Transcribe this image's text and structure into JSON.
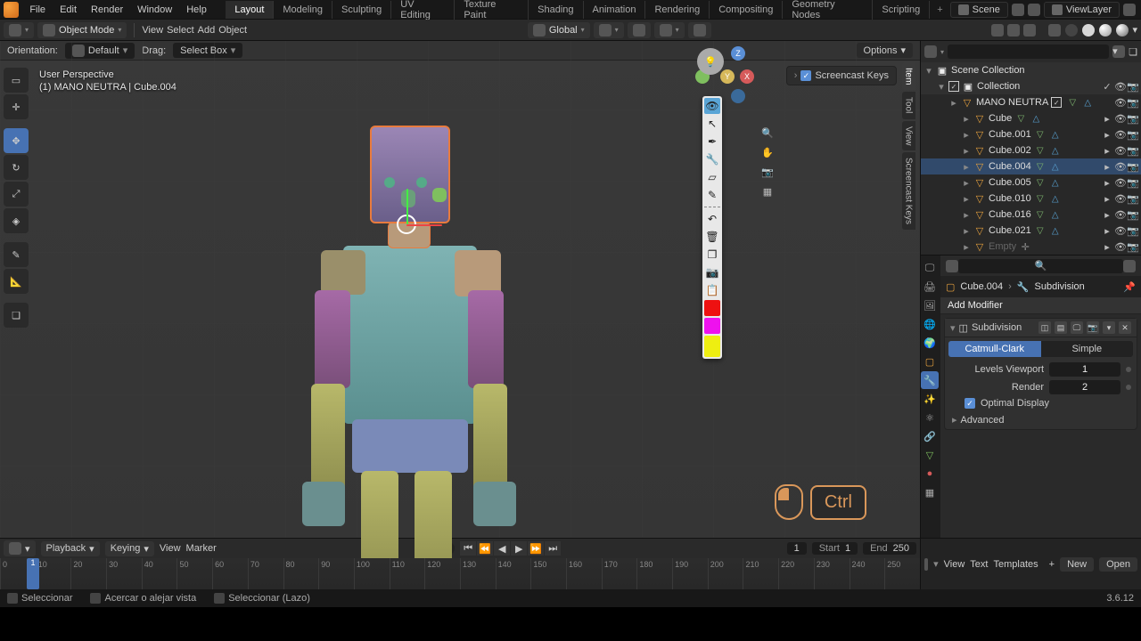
{
  "topbar": {
    "menus": [
      "File",
      "Edit",
      "Render",
      "Window",
      "Help"
    ],
    "workspaces": [
      "Layout",
      "Modeling",
      "Sculpting",
      "UV Editing",
      "Texture Paint",
      "Shading",
      "Animation",
      "Rendering",
      "Compositing",
      "Geometry Nodes",
      "Scripting"
    ],
    "active_workspace": 0,
    "scene_label": "Scene",
    "viewlayer_label": "ViewLayer"
  },
  "secondary": {
    "mode": "Object Mode",
    "menus": [
      "View",
      "Select",
      "Add",
      "Object"
    ],
    "orientation_label": "Global",
    "options_label": "Options"
  },
  "tertiary": {
    "orientation_label": "Orientation:",
    "orientation_value": "Default",
    "drag_label": "Drag:",
    "drag_value": "Select Box"
  },
  "viewport": {
    "perspective": "User Perspective",
    "info_line": "(1) MANO NEUTRA | Cube.004",
    "npanel_tabs": [
      "Item",
      "Tool",
      "View",
      "Screencast Keys"
    ],
    "npanel_active": 0,
    "npanel_checkbox_label": "Screencast Keys",
    "key_overlay": "Ctrl"
  },
  "outliner": {
    "root": "Scene Collection",
    "collection": "Collection",
    "items": [
      {
        "name": "MANO NEUTRA",
        "selected": false,
        "type": "mesh",
        "mods": 2,
        "checkbox": true
      },
      {
        "name": "Cube",
        "selected": false,
        "type": "mesh",
        "mods": 2,
        "child": true
      },
      {
        "name": "Cube.001",
        "selected": false,
        "type": "mesh",
        "mods": 2,
        "child": true
      },
      {
        "name": "Cube.002",
        "selected": false,
        "type": "mesh",
        "mods": 2,
        "child": true
      },
      {
        "name": "Cube.004",
        "selected": true,
        "type": "mesh",
        "mods": 2,
        "child": true
      },
      {
        "name": "Cube.005",
        "selected": false,
        "type": "mesh",
        "mods": 2,
        "child": true
      },
      {
        "name": "Cube.010",
        "selected": false,
        "type": "mesh",
        "mods": 2,
        "child": true
      },
      {
        "name": "Cube.016",
        "selected": false,
        "type": "mesh",
        "mods": 2,
        "child": true
      },
      {
        "name": "Cube.021",
        "selected": false,
        "type": "mesh",
        "mods": 2,
        "child": true
      },
      {
        "name": "Empty",
        "selected": false,
        "type": "empty",
        "mods": 0,
        "child": true,
        "disabled": true
      }
    ]
  },
  "properties": {
    "breadcrumb_obj": "Cube.004",
    "breadcrumb_mod": "Subdivision",
    "add_modifier": "Add Modifier",
    "modifier_name": "Subdivision",
    "seg_a": "Catmull-Clark",
    "seg_b": "Simple",
    "seg_active": 0,
    "field_viewport_label": "Levels Viewport",
    "field_viewport_value": "1",
    "field_render_label": "Render",
    "field_render_value": "2",
    "optimal_display_label": "Optimal Display",
    "advanced_label": "Advanced"
  },
  "timeline": {
    "menus": [
      "Playback",
      "Keying",
      "View",
      "Marker"
    ],
    "current_frame": "1",
    "start_label": "Start",
    "start_value": "1",
    "end_label": "End",
    "end_value": "250",
    "ticks": [
      "0",
      "10",
      "20",
      "30",
      "40",
      "50",
      "60",
      "70",
      "80",
      "90",
      "100",
      "110",
      "120",
      "130",
      "140",
      "150",
      "160",
      "170",
      "180",
      "190",
      "200",
      "210",
      "220",
      "230",
      "240",
      "250"
    ],
    "playhead": "1",
    "text_menus": [
      "View",
      "Text",
      "Templates"
    ],
    "text_new": "New",
    "text_open": "Open"
  },
  "statusbar": {
    "items": [
      "Seleccionar",
      "Acercar o alejar vista",
      "Seleccionar (Lazo)"
    ],
    "version": "3.6.12"
  }
}
